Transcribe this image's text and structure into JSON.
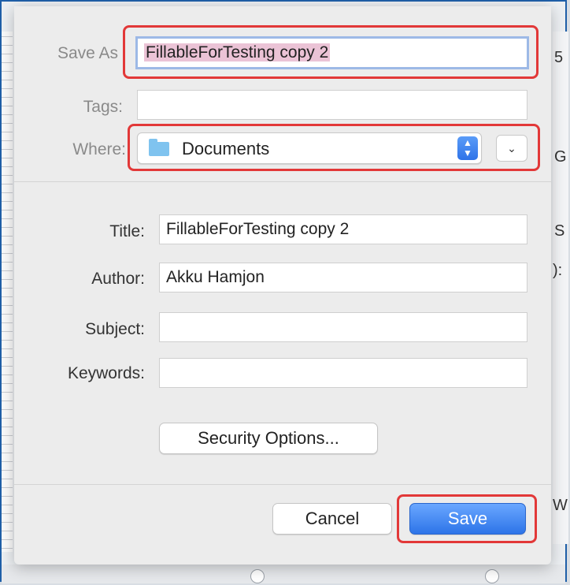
{
  "dialog": {
    "save_as_label": "Save As",
    "save_as_value": "FillableForTesting copy 2",
    "tags_label": "Tags:",
    "tags_value": "",
    "where_label": "Where:",
    "where_value": "Documents",
    "title_label": "Title:",
    "title_value": "FillableForTesting copy 2",
    "author_label": "Author:",
    "author_value": "Akku  Hamjon",
    "subject_label": "Subject:",
    "subject_value": "",
    "keywords_label": "Keywords:",
    "keywords_value": "",
    "security_button": "Security Options...",
    "cancel_button": "Cancel",
    "save_button": "Save"
  },
  "background": {
    "right_chars": [
      "5",
      "G",
      "S",
      "):",
      "W"
    ]
  },
  "colors": {
    "highlight": "#e23838",
    "primary": "#2d74e8",
    "selection": "#ebc3d6"
  }
}
